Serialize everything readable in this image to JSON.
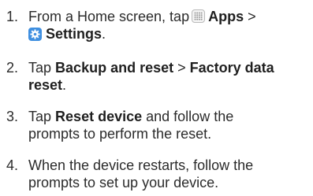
{
  "steps": [
    {
      "number": "1.",
      "line1_pre": "From a Home screen, tap",
      "apps_icon": "apps-grid-icon",
      "apps_label": "Apps",
      "separator": ">",
      "settings_icon": "settings-gear-icon",
      "settings_label": "Settings",
      "line2_post": "."
    },
    {
      "number": "2.",
      "pre": "Tap",
      "bold1": "Backup and reset",
      "separator": ">",
      "bold2_line1": "Factory data",
      "bold2_line2": "reset",
      "post": "."
    },
    {
      "number": "3.",
      "pre": "Tap",
      "bold": "Reset device",
      "line1_post": "and follow the",
      "line2": "prompts to perform the reset."
    },
    {
      "number": "4.",
      "line1": "When the device restarts, follow the",
      "line2": "prompts to set up your device."
    }
  ]
}
